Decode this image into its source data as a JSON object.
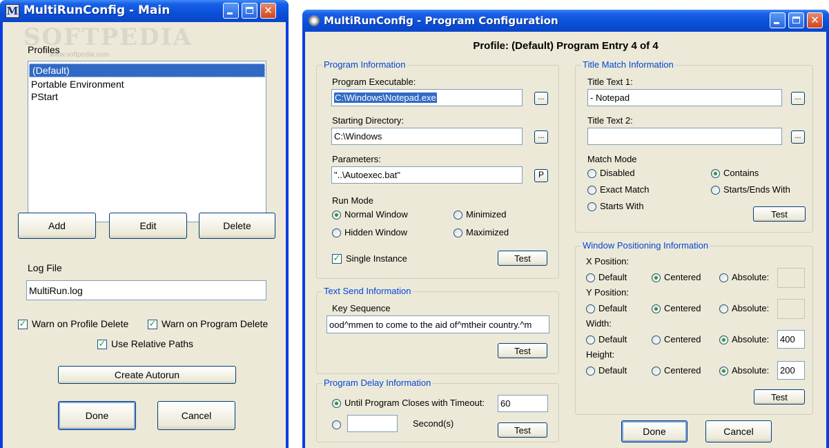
{
  "main_window": {
    "title": "MultiRunConfig - Main",
    "icon_letter": "M",
    "watermark": "SOFTPEDIA",
    "watermark_url": "www.softpedia.com",
    "profiles_label": "Profiles",
    "profiles": [
      "(Default)",
      "Portable Environment",
      "PStart"
    ],
    "selected_profile": "(Default)",
    "add_label": "Add",
    "edit_label": "Edit",
    "delete_label": "Delete",
    "log_file_label": "Log File",
    "log_file_value": "MultiRun.log",
    "warn_profile_delete": "Warn on Profile Delete",
    "warn_program_delete": "Warn on Program Delete",
    "use_relative_paths": "Use Relative Paths",
    "create_autorun_label": "Create Autorun",
    "done_label": "Done",
    "cancel_label": "Cancel"
  },
  "config_window": {
    "title": "MultiRunConfig - Program Configuration",
    "header": "Profile: (Default)  Program Entry 4 of 4",
    "program_info": {
      "legend": "Program Information",
      "exe_label": "Program Executable:",
      "exe_value": "C:\\Windows\\Notepad.exe",
      "dir_label": "Starting Directory:",
      "dir_value": "C:\\Windows",
      "params_label": "Parameters:",
      "params_value": "\"..\\Autoexec.bat\"",
      "params_button": "P",
      "browse": "...",
      "run_mode_label": "Run Mode",
      "normal": "Normal Window",
      "minimized": "Minimized",
      "hidden": "Hidden Window",
      "maximized": "Maximized",
      "single_instance": "Single Instance",
      "test_label": "Test"
    },
    "text_send": {
      "legend": "Text Send Information",
      "key_label": "Key Sequence",
      "key_value": "ood^mmen to come to the aid of^mtheir country.^m",
      "test_label": "Test"
    },
    "delay": {
      "legend": "Program Delay Information",
      "until_label": "Until Program Closes with Timeout:",
      "timeout_value": "60",
      "seconds_label": "Second(s)",
      "test_label": "Test"
    },
    "title_match": {
      "legend": "Title Match Information",
      "t1_label": "Title Text 1:",
      "t1_value": "- Notepad",
      "t2_label": "Title Text 2:",
      "t2_value": "",
      "mode_label": "Match Mode",
      "disabled": "Disabled",
      "contains": "Contains",
      "exact": "Exact Match",
      "starts_ends": "Starts/Ends With",
      "starts": "Starts With",
      "test_label": "Test"
    },
    "window_pos": {
      "legend": "Window Positioning Information",
      "x_label": "X Position:",
      "y_label": "Y Position:",
      "w_label": "Width:",
      "h_label": "Height:",
      "default": "Default",
      "centered": "Centered",
      "absolute": "Absolute:",
      "x_value": "",
      "y_value": "",
      "w_value": "400",
      "h_value": "200",
      "test_label": "Test"
    },
    "done_label": "Done",
    "cancel_label": "Cancel"
  }
}
